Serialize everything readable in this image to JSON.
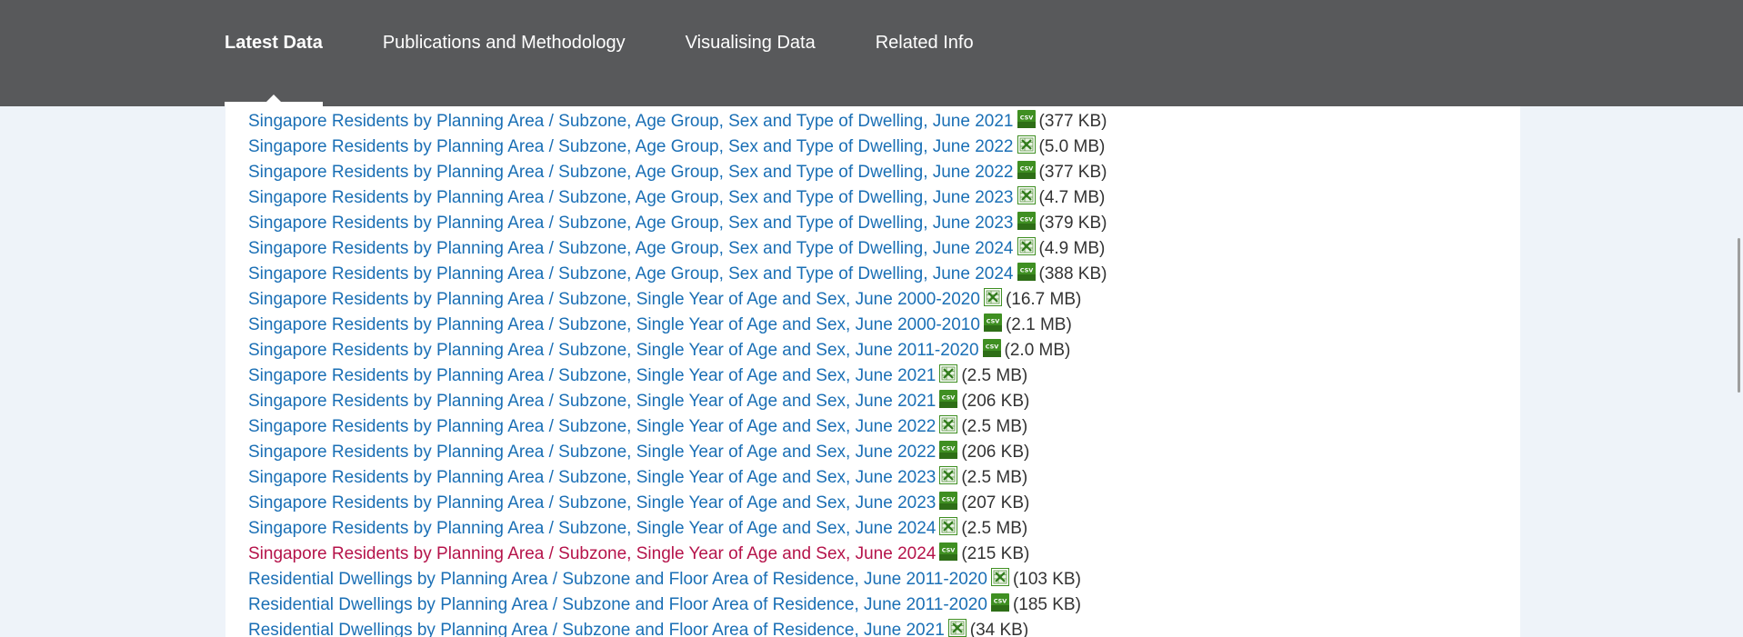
{
  "nav": {
    "tabs": [
      {
        "label": "Latest Data",
        "active": true
      },
      {
        "label": "Publications and Methodology",
        "active": false
      },
      {
        "label": "Visualising Data",
        "active": false
      },
      {
        "label": "Related Info",
        "active": false
      }
    ]
  },
  "colors": {
    "nav_bg": "#58595b",
    "page_bg": "#eef3f9",
    "link": "#1a6fb5",
    "link_visited": "#b5134a",
    "icon_green": "#3f8f22"
  },
  "files": [
    {
      "title": "Singapore Residents by Planning Area / Subzone, Age Group, Sex and Type of Dwelling, June 2021",
      "icon": "csv-icon",
      "size": "(377 KB)",
      "visited": false
    },
    {
      "title": "Singapore Residents by Planning Area / Subzone, Age Group, Sex and Type of Dwelling, June 2022",
      "icon": "excel-icon",
      "size": "(5.0 MB)",
      "visited": false
    },
    {
      "title": "Singapore Residents by Planning Area / Subzone, Age Group, Sex and Type of Dwelling, June 2022",
      "icon": "csv-icon",
      "size": "(377 KB)",
      "visited": false
    },
    {
      "title": "Singapore Residents by Planning Area / Subzone, Age Group, Sex and Type of Dwelling, June 2023",
      "icon": "excel-icon",
      "size": "(4.7 MB)",
      "visited": false
    },
    {
      "title": "Singapore Residents by Planning Area / Subzone, Age Group, Sex and Type of Dwelling, June 2023",
      "icon": "csv-icon",
      "size": "(379 KB)",
      "visited": false
    },
    {
      "title": "Singapore Residents by Planning Area / Subzone, Age Group, Sex and Type of Dwelling, June 2024",
      "icon": "excel-icon",
      "size": "(4.9 MB)",
      "visited": false
    },
    {
      "title": "Singapore Residents by Planning Area / Subzone, Age Group, Sex and Type of Dwelling, June 2024",
      "icon": "csv-icon",
      "size": "(388 KB)",
      "visited": false
    },
    {
      "title": "Singapore Residents by Planning Area / Subzone, Single Year of Age and Sex, June 2000-2020",
      "icon": "excel-icon",
      "size": "(16.7 MB)",
      "visited": false
    },
    {
      "title": "Singapore Residents by Planning Area / Subzone, Single Year of Age and Sex, June 2000-2010",
      "icon": "csv-icon",
      "size": "(2.1 MB)",
      "visited": false
    },
    {
      "title": "Singapore Residents by Planning Area / Subzone, Single Year of Age and Sex, June 2011-2020",
      "icon": "csv-icon",
      "size": "(2.0 MB)",
      "visited": false
    },
    {
      "title": "Singapore Residents by Planning Area / Subzone, Single Year of Age and Sex, June 2021",
      "icon": "excel-icon",
      "size": "(2.5 MB)",
      "visited": false
    },
    {
      "title": "Singapore Residents by Planning Area / Subzone, Single Year of Age and Sex, June 2021",
      "icon": "csv-icon",
      "size": "(206 KB)",
      "visited": false
    },
    {
      "title": "Singapore Residents by Planning Area / Subzone, Single Year of Age and Sex, June 2022",
      "icon": "excel-icon",
      "size": "(2.5 MB)",
      "visited": false
    },
    {
      "title": "Singapore Residents by Planning Area / Subzone, Single Year of Age and Sex, June 2022",
      "icon": "csv-icon",
      "size": "(206 KB)",
      "visited": false
    },
    {
      "title": "Singapore Residents by Planning Area / Subzone, Single Year of Age and Sex, June 2023",
      "icon": "excel-icon",
      "size": "(2.5 MB)",
      "visited": false
    },
    {
      "title": "Singapore Residents by Planning Area / Subzone, Single Year of Age and Sex, June 2023",
      "icon": "csv-icon",
      "size": "(207 KB)",
      "visited": false
    },
    {
      "title": "Singapore Residents by Planning Area / Subzone, Single Year of Age and Sex, June 2024",
      "icon": "excel-icon",
      "size": "(2.5 MB)",
      "visited": false
    },
    {
      "title": "Singapore Residents by Planning Area / Subzone, Single Year of Age and Sex, June 2024",
      "icon": "csv-icon",
      "size": "(215 KB)",
      "visited": true
    },
    {
      "title": "Residential Dwellings by Planning Area / Subzone and Floor Area of Residence, June 2011-2020",
      "icon": "excel-icon",
      "size": "(103 KB)",
      "visited": false
    },
    {
      "title": "Residential Dwellings by Planning Area / Subzone and Floor Area of Residence, June 2011-2020",
      "icon": "csv-icon",
      "size": "(185 KB)",
      "visited": false
    },
    {
      "title": "Residential Dwellings by Planning Area / Subzone and Floor Area of Residence, June 2021",
      "icon": "excel-icon",
      "size": "(34 KB)",
      "visited": false
    }
  ]
}
